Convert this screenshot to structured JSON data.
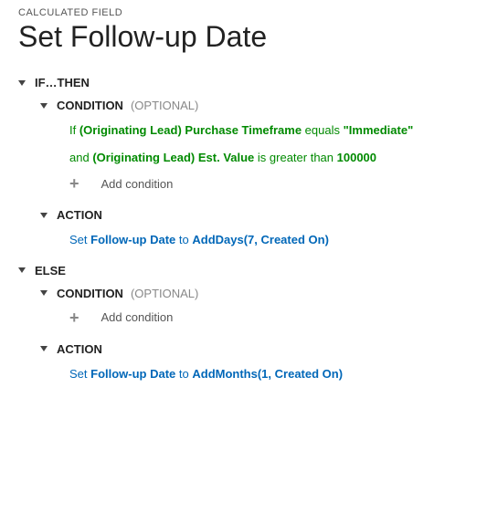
{
  "breadcrumb": "CALCULATED FIELD",
  "title": "Set Follow-up Date",
  "ifthen": {
    "label": "IF…THEN",
    "condition": {
      "label": "CONDITION",
      "optional": "(OPTIONAL)",
      "line1": {
        "p1": "If ",
        "field1": "(Originating Lead) Purchase Timeframe",
        "op": " equals ",
        "val": "\"Immediate\""
      },
      "line2": {
        "p1": "and ",
        "field1": "(Originating Lead) Est. Value",
        "op": " is greater than ",
        "val": "100000"
      },
      "add": "Add condition"
    },
    "action": {
      "label": "ACTION",
      "line": {
        "p1": "Set ",
        "field": "Follow-up Date",
        "p2": " to ",
        "fn": "AddDays(7, Created On)"
      }
    }
  },
  "else": {
    "label": "ELSE",
    "condition": {
      "label": "CONDITION",
      "optional": "(OPTIONAL)",
      "add": "Add condition"
    },
    "action": {
      "label": "ACTION",
      "line": {
        "p1": "Set ",
        "field": "Follow-up Date",
        "p2": " to ",
        "fn": "AddMonths(1, Created On)"
      }
    }
  }
}
